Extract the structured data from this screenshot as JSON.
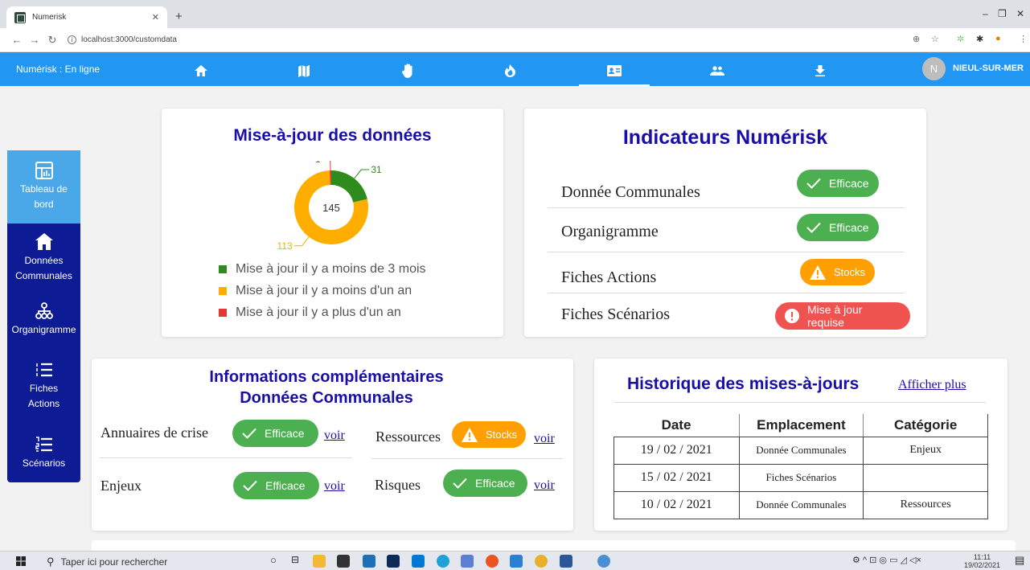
{
  "browser": {
    "tab_title": "Numerisk",
    "url": "localhost:3000/customdata"
  },
  "appbar": {
    "status": "Numérisk : En ligne",
    "nav_icons": [
      "home-icon",
      "map-icon",
      "hand-icon",
      "fire-icon",
      "id-card-icon",
      "people-icon",
      "download-icon"
    ],
    "active_nav": "id-card-icon",
    "avatar_initial": "N",
    "city": "NIEUL-SUR-MER"
  },
  "sidebar": {
    "items": [
      {
        "label": "Tableau de bord",
        "icon": "dashboard-icon"
      },
      {
        "label": "Données Communales",
        "icon": "home-icon"
      },
      {
        "label": "Organigramme",
        "icon": "org-chart-icon"
      },
      {
        "label": "Fiches Actions",
        "icon": "list-icon"
      },
      {
        "label": "Scénarios",
        "icon": "list-numbered-icon"
      }
    ]
  },
  "update_card": {
    "title": "Mise-à-jour des données",
    "total": "145",
    "legend": [
      {
        "label": "Mise à jour il y a moins de 3 mois",
        "color": "#2e8b1e"
      },
      {
        "label": "Mise à jour il y a moins d'un an",
        "color": "#ffae00"
      },
      {
        "label": "Mise à jour il y a plus d'un an",
        "color": "#e53935"
      }
    ]
  },
  "chart_data": {
    "type": "pie",
    "categories": [
      "Mise à jour il y a moins de 3 mois",
      "Mise à jour il y a moins d'un an",
      "Mise à jour il y a plus d'un an"
    ],
    "values": [
      31,
      113,
      1
    ],
    "colors": [
      "#2e8b1e",
      "#ffae00",
      "#e53935"
    ],
    "center_label": "145"
  },
  "indicators": {
    "title": "Indicateurs Numérisk",
    "rows": [
      {
        "label": "Donnée Communales",
        "status": "Efficace",
        "kind": "green"
      },
      {
        "label": "Organigramme",
        "status": "Efficace",
        "kind": "green"
      },
      {
        "label": "Fiches Actions",
        "status": "Stocks",
        "kind": "orange"
      },
      {
        "label": "Fiches Scénarios",
        "status": "Mise à jour requise",
        "kind": "red"
      }
    ]
  },
  "complementary": {
    "title_line1": "Informations complémentaires",
    "title_line2": "Données Communales",
    "voir": "voir",
    "items": [
      {
        "label": "Annuaires de crise",
        "status": "Efficace"
      },
      {
        "label": "Ressources",
        "status": "Stocks"
      },
      {
        "label": "Enjeux",
        "status": "Efficace"
      },
      {
        "label": "Risques",
        "status": "Efficace"
      }
    ]
  },
  "history": {
    "title": "Historique des mises-à-jours",
    "more_link": "Afficher plus",
    "columns": [
      "Date",
      "Emplacement",
      "Catégorie"
    ],
    "rows": [
      [
        "19 / 02 / 2021",
        "Donnée Communales",
        "Enjeux"
      ],
      [
        "15 / 02 / 2021",
        "Fiches Scénarios",
        ""
      ],
      [
        "10 / 02 / 2021",
        "Donnée Communales",
        "Ressources"
      ]
    ]
  },
  "taskbar": {
    "search_placeholder": "Taper ici pour rechercher",
    "time": "11:11",
    "date": "19/02/2021"
  }
}
